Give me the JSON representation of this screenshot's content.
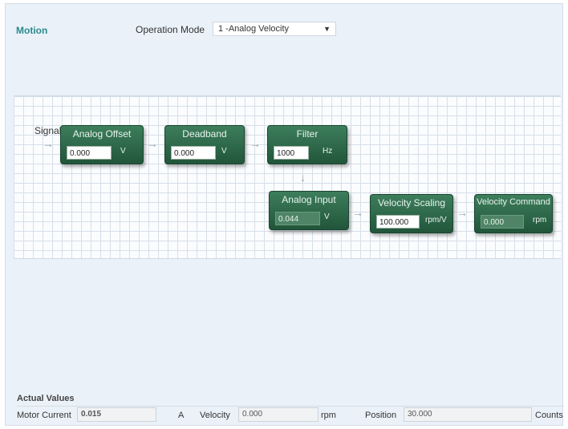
{
  "header": {
    "title": "Motion",
    "operation_mode_label": "Operation Mode",
    "operation_mode_value": "1 -Analog Velocity"
  },
  "diagram": {
    "signal_label": "Signal",
    "blocks": {
      "analog_offset": {
        "title": "Analog Offset",
        "value": "0.000",
        "unit": "V"
      },
      "deadband": {
        "title": "Deadband",
        "value": "0.000",
        "unit": "V"
      },
      "filter": {
        "title": "Filter",
        "value": "1000",
        "unit": "Hz"
      },
      "analog_input": {
        "title": "Analog Input",
        "value": "0.044",
        "unit": "V"
      },
      "velocity_scaling": {
        "title": "Velocity Scaling",
        "value": "100.000",
        "unit": "rpm/V"
      },
      "velocity_command": {
        "title": "Velocity Command",
        "value": "0.000",
        "unit": "rpm"
      }
    }
  },
  "actual_values": {
    "title": "Actual Values",
    "motor_current": {
      "label": "Motor Current",
      "value": "0.015",
      "unit": "A"
    },
    "velocity": {
      "label": "Velocity",
      "value": "0.000",
      "unit": "rpm"
    },
    "position": {
      "label": "Position",
      "value": "30.000",
      "unit": "Counts"
    }
  }
}
